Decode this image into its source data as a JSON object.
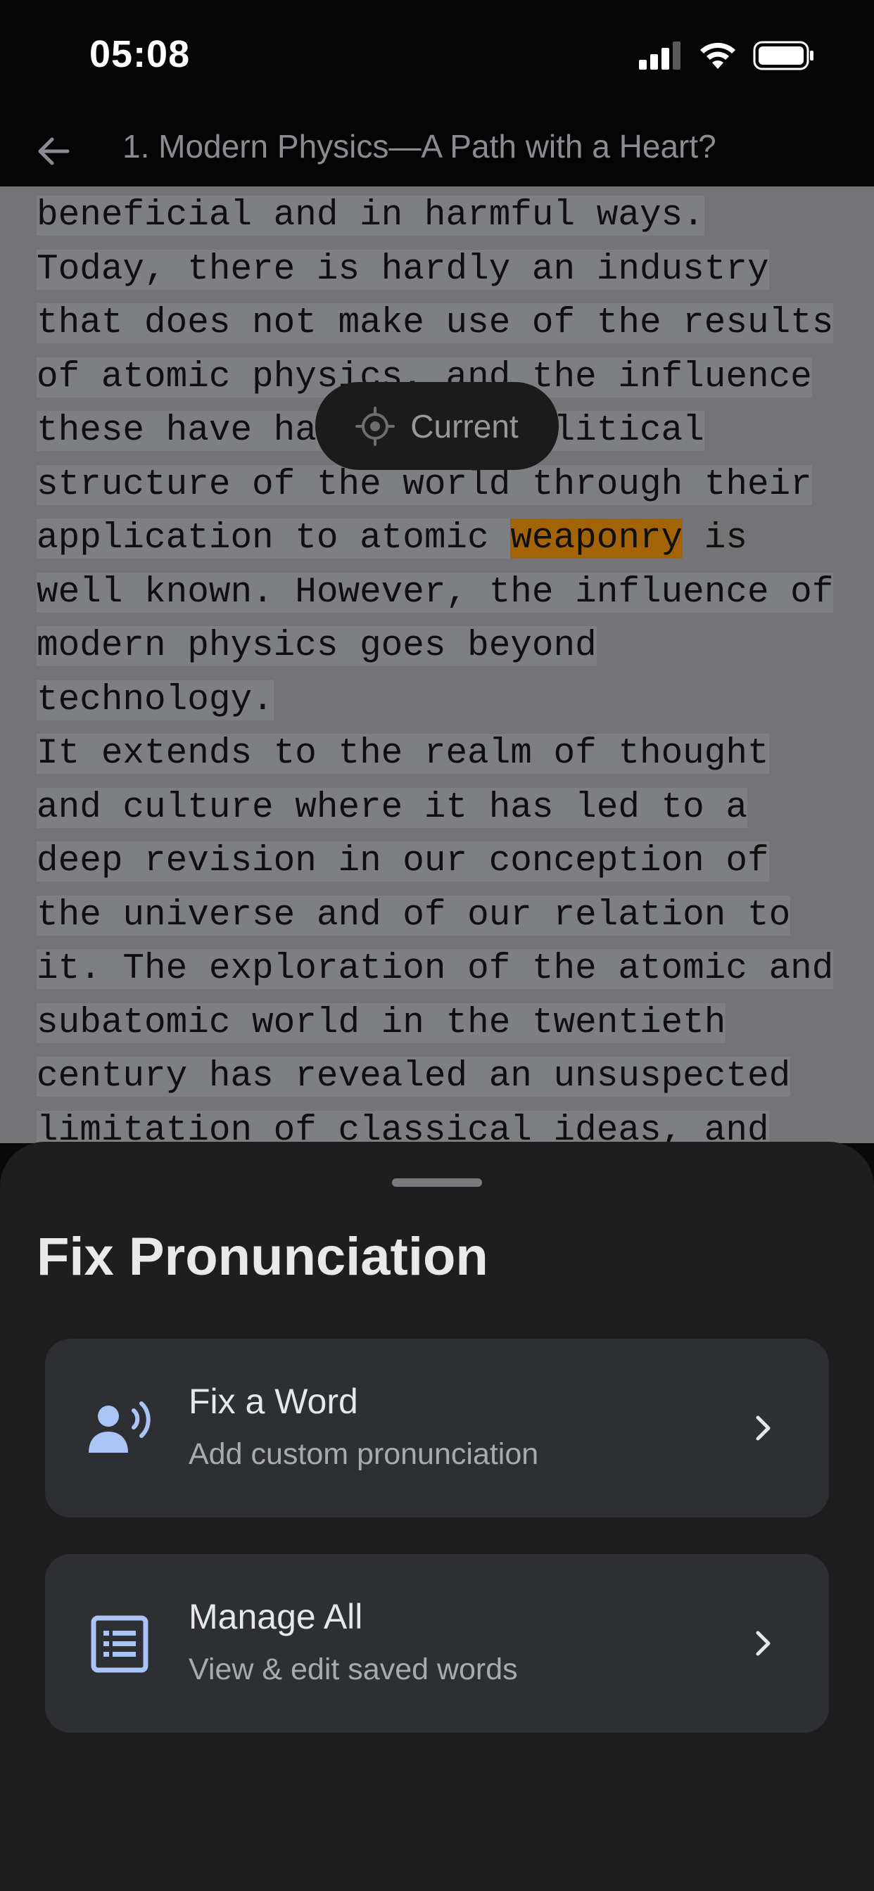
{
  "status_bar": {
    "time": "05:08",
    "icons": [
      "cellular-signal-icon",
      "wifi-icon",
      "battery-icon"
    ]
  },
  "header": {
    "back_icon": "back-arrow-icon",
    "title": "1. Modern Physics—A Path with a Heart?"
  },
  "reader": {
    "lines": [
      {
        "pre": "beneficial and in harmful ways.",
        "highlight": "",
        "post": ""
      },
      {
        "pre": "Today, there is hardly an industry",
        "highlight": "",
        "post": ""
      },
      {
        "pre": "that does not make use of the results",
        "highlight": "",
        "post": ""
      },
      {
        "pre": "of atomic physics, and the influence",
        "highlight": "",
        "post": ""
      },
      {
        "pre": "these have had on the political",
        "highlight": "",
        "post": ""
      },
      {
        "pre": "structure of the world through their",
        "highlight": "",
        "post": ""
      },
      {
        "pre": "application to atomic ",
        "highlight": "weaponry",
        "post": " is"
      },
      {
        "pre": "well known. However, the influence of",
        "highlight": "",
        "post": ""
      },
      {
        "pre": "modern physics goes beyond",
        "highlight": "",
        "post": ""
      },
      {
        "pre": "technology.",
        "highlight": "",
        "post": ""
      },
      {
        "pre": "It extends to the realm of thought",
        "highlight": "",
        "post": ""
      },
      {
        "pre": "and culture where it has led to a",
        "highlight": "",
        "post": ""
      },
      {
        "pre": "deep revision in our conception of",
        "highlight": "",
        "post": ""
      },
      {
        "pre": "the universe and of our relation to",
        "highlight": "",
        "post": ""
      },
      {
        "pre": "it. The exploration of the atomic and",
        "highlight": "",
        "post": ""
      },
      {
        "pre": "subatomic world in the twentieth",
        "highlight": "",
        "post": ""
      },
      {
        "pre": "century has revealed an unsuspected",
        "highlight": "",
        "post": ""
      },
      {
        "pre": "limitation of classical ideas, and",
        "highlight": "",
        "post": ""
      }
    ],
    "current_button": {
      "label": "Current",
      "icon": "crosshair-icon"
    }
  },
  "sheet": {
    "title": "Fix Pronunciation",
    "options": [
      {
        "title": "Fix a Word",
        "subtitle": "Add custom pronunciation",
        "icon": "speaking-person-icon"
      },
      {
        "title": "Manage All",
        "subtitle": "View & edit saved words",
        "icon": "list-icon"
      }
    ]
  },
  "colors": {
    "accent_blue": "#a9c4f5",
    "highlight": "#a36408",
    "sheet_bg": "#1e1e1f",
    "card_bg": "#2e2f33"
  }
}
